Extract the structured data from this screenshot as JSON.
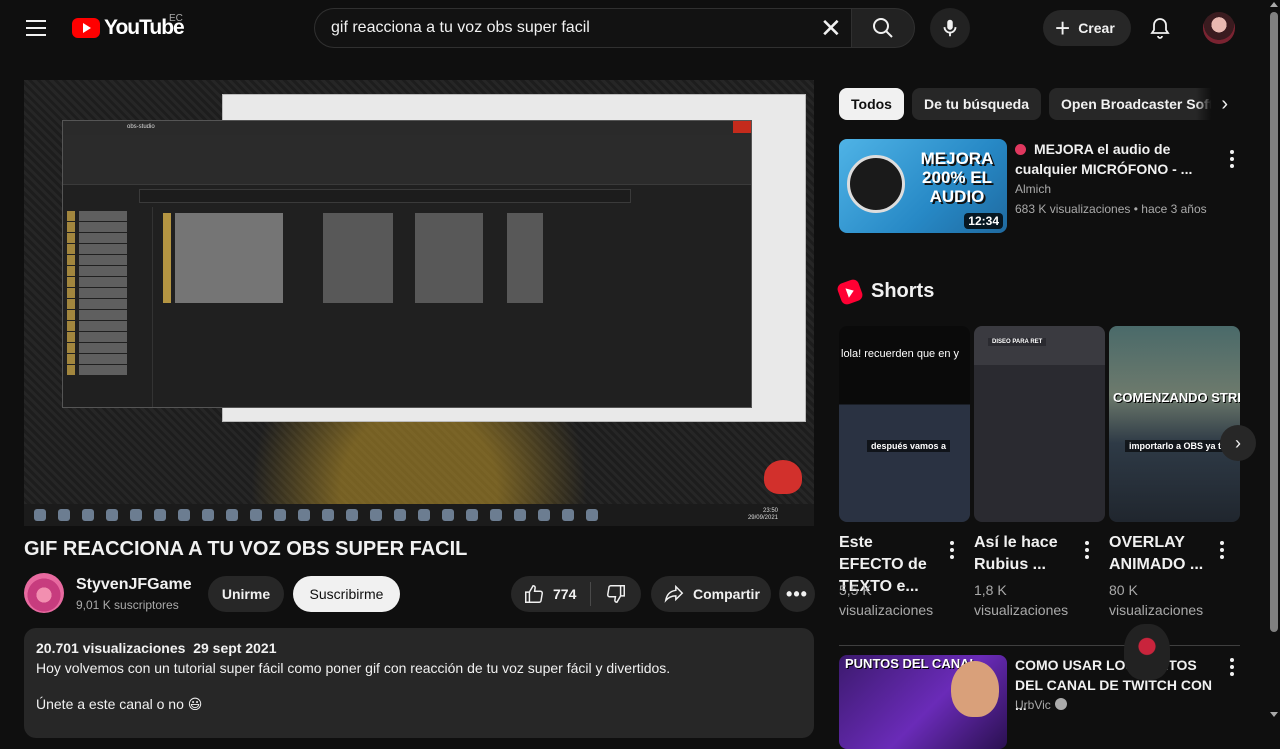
{
  "header": {
    "logo_text": "YouTube",
    "country_code": "EC",
    "search_value": "gif reacciona a tu voz obs super facil",
    "clear_glyph": "✕",
    "create_label": "Crear",
    "create_glyph": "+",
    "icons": [
      "menu-icon",
      "search-icon",
      "mic-icon",
      "bell-icon"
    ]
  },
  "video": {
    "title": "GIF REACCIONA A TU VOZ OBS SUPER FACIL",
    "desktop_window_title": "obs-studio",
    "desktop_clock_time": "23:50",
    "desktop_clock_date": "29/09/2021"
  },
  "channel": {
    "name": "StyvenJFGame",
    "subscribers": "9,01 K suscriptores",
    "join_label": "Unirme",
    "subscribe_label": "Suscribirme"
  },
  "actions": {
    "likes": "774",
    "share_label": "Compartir",
    "more_glyph": "•••"
  },
  "description": {
    "views": "20.701 visualizaciones",
    "date": "29 sept 2021",
    "line1": "Hoy volvemos con un tutorial super fácil como poner gif con reacción de tu voz super fácil y divertidos.",
    "line2": "Únete a este canal o no 😃"
  },
  "chips": [
    "Todos",
    "De tu búsqueda",
    "Open Broadcaster Software"
  ],
  "chip_next_glyph": "›",
  "recommended": [
    {
      "title": "MEJORA el audio de cualquier MICRÓFONO - ...",
      "channel": "Almich",
      "meta": "683 K visualizaciones • hace 3 años",
      "duration": "12:34",
      "thumb_text": "MEJORA 200% EL AUDIO"
    },
    {
      "title": "COMO USAR LOS PUNTOS DEL CANAL DE TWITCH CON ...",
      "channel": "UrbVic",
      "thumb_text": "PUNTOS DEL CANAL"
    }
  ],
  "shorts": {
    "heading": "Shorts",
    "next_glyph": "›",
    "items": [
      {
        "title": "Este EFECTO de TEXTO e...",
        "views": "5,5 K",
        "views_unit": "visualizaciones",
        "caption_top": "lola! recuerden que en y",
        "caption_mid": "después vamos a"
      },
      {
        "title": "Así le hace Rubius ...",
        "views": "1,8 K",
        "views_unit": "visualizaciones",
        "caption_top": "DISEO PARA RET"
      },
      {
        "title": "OVERLAY ANIMADO ...",
        "views": "80 K",
        "views_unit": "visualizaciones",
        "caption_top": "COMENZANDO STREAM",
        "caption_mid": "importarlo a OBS ya todo"
      }
    ]
  },
  "colors": {
    "background": "#0f0f0f",
    "surface": "#272727",
    "brand_red": "#ff0000",
    "text_secondary": "#aaaaaa"
  }
}
